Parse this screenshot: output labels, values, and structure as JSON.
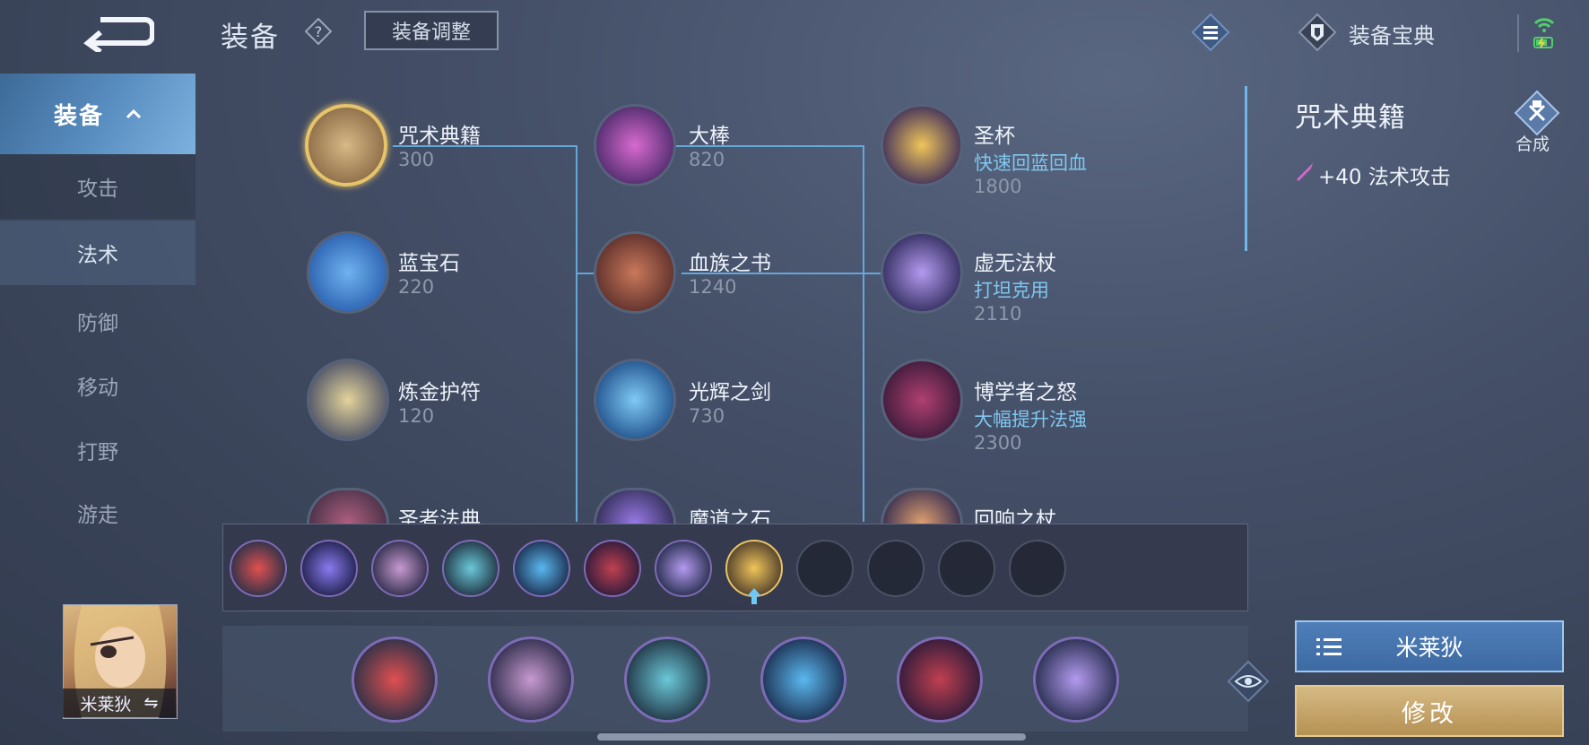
{
  "header": {
    "title": "装备",
    "adjust_label": "装备调整",
    "codex_label": "装备宝典"
  },
  "sidebar": {
    "head_label": "装备",
    "items": [
      {
        "label": "攻击"
      },
      {
        "label": "法术"
      },
      {
        "label": "防御"
      },
      {
        "label": "移动"
      },
      {
        "label": "打野"
      },
      {
        "label": "游走"
      }
    ]
  },
  "hero": {
    "name": "米莱狄",
    "swap_icon": "⇋"
  },
  "tree": {
    "col1": [
      {
        "name": "咒术典籍",
        "price": "300",
        "icon": "spellbook-icon",
        "color": "#c9a46b"
      },
      {
        "name": "蓝宝石",
        "price": "220",
        "icon": "sapphire-icon",
        "color": "#3b7fd1"
      },
      {
        "name": "炼金护符",
        "price": "120",
        "icon": "amulet-icon",
        "color": "#c9b36b"
      },
      {
        "name": "圣者法典",
        "price": "",
        "icon": "codex-icon",
        "color": "#8a4d6e"
      }
    ],
    "col2": [
      {
        "name": "大棒",
        "price": "820",
        "icon": "staff-icon",
        "color": "#8e3da1"
      },
      {
        "name": "血族之书",
        "price": "1240",
        "icon": "blood-book-icon",
        "color": "#a45540"
      },
      {
        "name": "光辉之剑",
        "price": "730",
        "icon": "radiant-sword-icon",
        "color": "#2f7dc9"
      },
      {
        "name": "魔道之石",
        "price": "",
        "icon": "magic-stone-icon",
        "color": "#6a4fbf"
      }
    ],
    "col3": [
      {
        "name": "圣杯",
        "desc": "快速回蓝回血",
        "price": "1800",
        "icon": "holy-grail-icon",
        "color": "#c79a3a"
      },
      {
        "name": "虚无法杖",
        "desc": "打坦克用",
        "price": "2110",
        "icon": "void-staff-icon",
        "color": "#7b5bd1"
      },
      {
        "name": "博学者之怒",
        "desc": "大幅提升法强",
        "price": "2300",
        "icon": "scholar-fury-icon",
        "color": "#8a2a4a"
      },
      {
        "name": "回响之杖",
        "desc": "",
        "price": "",
        "icon": "echo-staff-icon",
        "color": "#b86a3a"
      }
    ]
  },
  "build_strip": [
    {
      "icon": "boots-icon",
      "color": "#b13a3a"
    },
    {
      "icon": "orb-icon",
      "color": "#6a4fd8"
    },
    {
      "icon": "skull-mask-icon",
      "color": "#a06aa8"
    },
    {
      "icon": "scythe-icon",
      "color": "#3a8a9a"
    },
    {
      "icon": "water-staff-icon",
      "color": "#2f8bd0"
    },
    {
      "icon": "wizard-hat-icon",
      "color": "#7a2a3a"
    },
    {
      "icon": "void-staff-icon",
      "color": "#7b5bd1"
    },
    {
      "icon": "holy-grail-icon",
      "color": "#c79a3a"
    }
  ],
  "build_strip_empty": 4,
  "final_build": [
    {
      "icon": "boots-icon",
      "color": "#b13a3a"
    },
    {
      "icon": "skull-mask-icon",
      "color": "#a06aa8"
    },
    {
      "icon": "scythe-icon",
      "color": "#3a8a9a"
    },
    {
      "icon": "water-staff-icon",
      "color": "#2f8bd0"
    },
    {
      "icon": "wizard-hat-icon",
      "color": "#7a2a3a"
    },
    {
      "icon": "void-staff-icon",
      "color": "#7b5bd1"
    }
  ],
  "detail": {
    "title": "咒术典籍",
    "combine_label": "合成",
    "attribute": "+40 法术攻击"
  },
  "actions": {
    "name_button": "米莱狄",
    "edit_button": "修改"
  },
  "colors": {
    "accent_blue": "#64a7d9",
    "highlight_gold": "#e7c46a",
    "desc_cyan": "#7fc7ef"
  }
}
